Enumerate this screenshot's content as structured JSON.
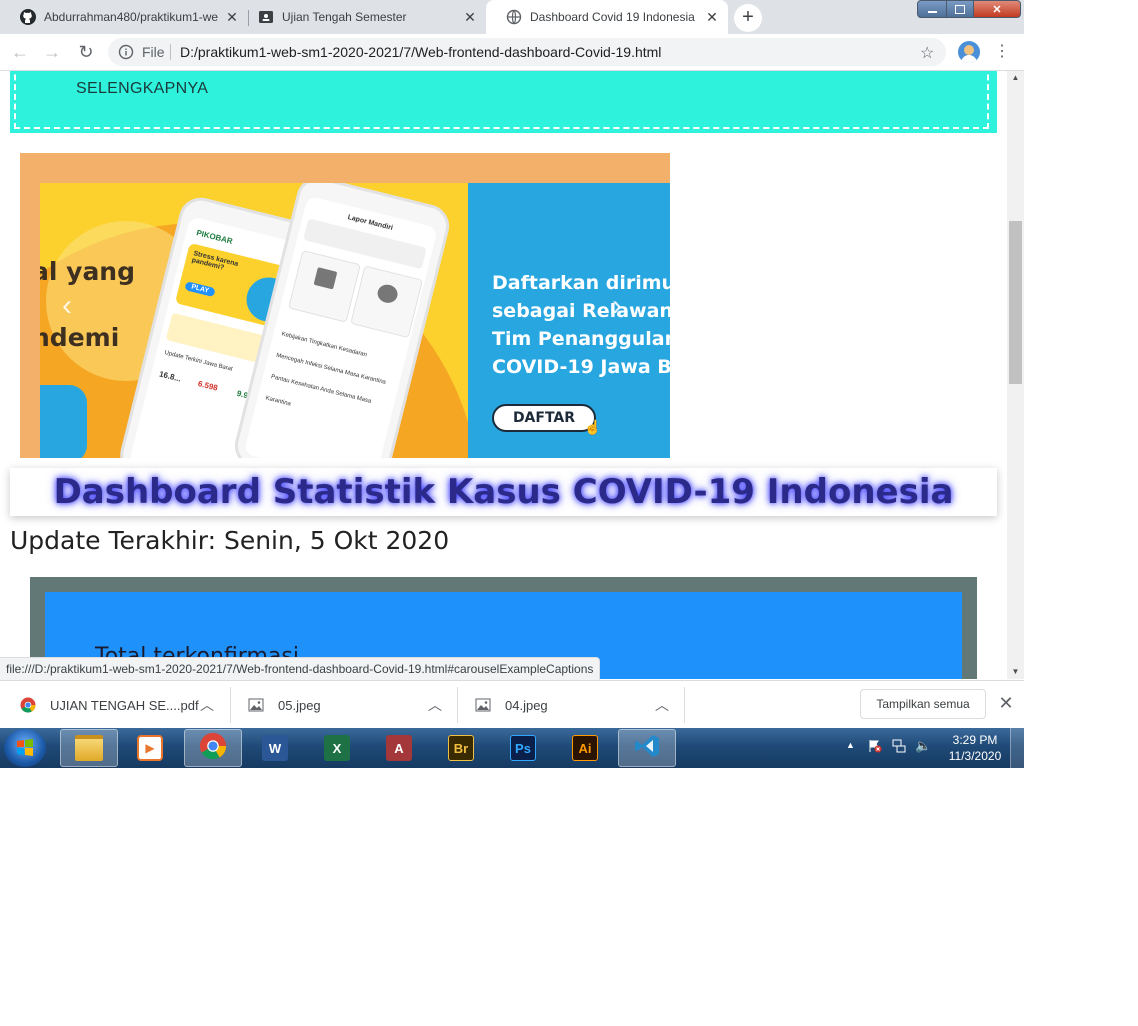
{
  "browser": {
    "tabs": [
      {
        "title": "Abdurrahman480/praktikum1-we",
        "icon": "github-icon"
      },
      {
        "title": "Ujian Tengah Semester",
        "icon": "classroom-icon"
      },
      {
        "title": "Dashboard Covid 19 Indonesia",
        "icon": "globe-icon"
      }
    ],
    "close_glyph": "✕",
    "new_tab_glyph": "+",
    "address": {
      "scheme_label": "File",
      "url": "D:/praktikum1-web-sm1-2020-2021/7/Web-frontend-dashboard-Covid-19.html"
    },
    "status_url": "file:///D:/praktikum1-web-sm1-2020-2021/7/Web-frontend-dashboard-Covid-19.html#carouselExampleCaptions"
  },
  "page": {
    "jumbotron_link": "SELENGKAPNYA",
    "carousel": {
      "left_text": [
        "al yang",
        "ndemi"
      ],
      "right_text": [
        "Daftarkan dirimu",
        "sebagai Relawan",
        "Tim Penanggulan",
        "COVID-19 Jawa B"
      ],
      "button": "DAFTAR",
      "prev_glyph": "‹",
      "next_glyph": "›",
      "app_tag": "PIKOBAR",
      "app_greeting": "Stress karena pandemi?",
      "app_play": "PLAY",
      "app_update": "Update Terkini Jawa Barat",
      "app_stats": [
        "16.8...",
        "6.598",
        "9.910"
      ],
      "app_screen_title": "Lapor Mandiri",
      "app_news": [
        "Kebijakan Tingkatkan Kesadaran",
        "Mencegah Infeksi Selama Masa Karantina",
        "Pantau Kesehatan Anda Selama Masa Karantina"
      ]
    },
    "title": "Dashboard Statistik Kasus COVID-19 Indonesia",
    "update": "Update Terakhir: Senin, 5 Okt 2020",
    "card_title": "Total terkonfirmasi"
  },
  "downloads": {
    "items": [
      {
        "name": "UJIAN TENGAH SE....pdf",
        "icon": "chrome-icon"
      },
      {
        "name": "05.jpeg",
        "icon": "image-file-icon"
      },
      {
        "name": "04.jpeg",
        "icon": "image-file-icon"
      }
    ],
    "show_all": "Tampilkan semua"
  },
  "taskbar": {
    "apps": [
      {
        "name": "Windows Explorer",
        "icon": "folder-icon",
        "label": ""
      },
      {
        "name": "Media Player",
        "icon": "media-player-icon",
        "label": ""
      },
      {
        "name": "Google Chrome",
        "icon": "chrome-icon",
        "label": ""
      },
      {
        "name": "Word",
        "icon": "word-icon",
        "label": "W",
        "color": "#2b5797"
      },
      {
        "name": "Excel",
        "icon": "excel-icon",
        "label": "X",
        "color": "#1e7145"
      },
      {
        "name": "Access",
        "icon": "access-icon",
        "label": "A",
        "color": "#a4373a"
      },
      {
        "name": "Bridge",
        "icon": "bridge-icon",
        "label": "Br",
        "color": "#3a2a00"
      },
      {
        "name": "Photoshop",
        "icon": "photoshop-icon",
        "label": "Ps",
        "color": "#0a1f4a"
      },
      {
        "name": "Illustrator",
        "icon": "illustrator-icon",
        "label": "Ai",
        "color": "#2a1400"
      },
      {
        "name": "VS Code",
        "icon": "vscode-icon",
        "label": ""
      }
    ],
    "time": "3:29 PM",
    "date": "11/3/2020"
  }
}
